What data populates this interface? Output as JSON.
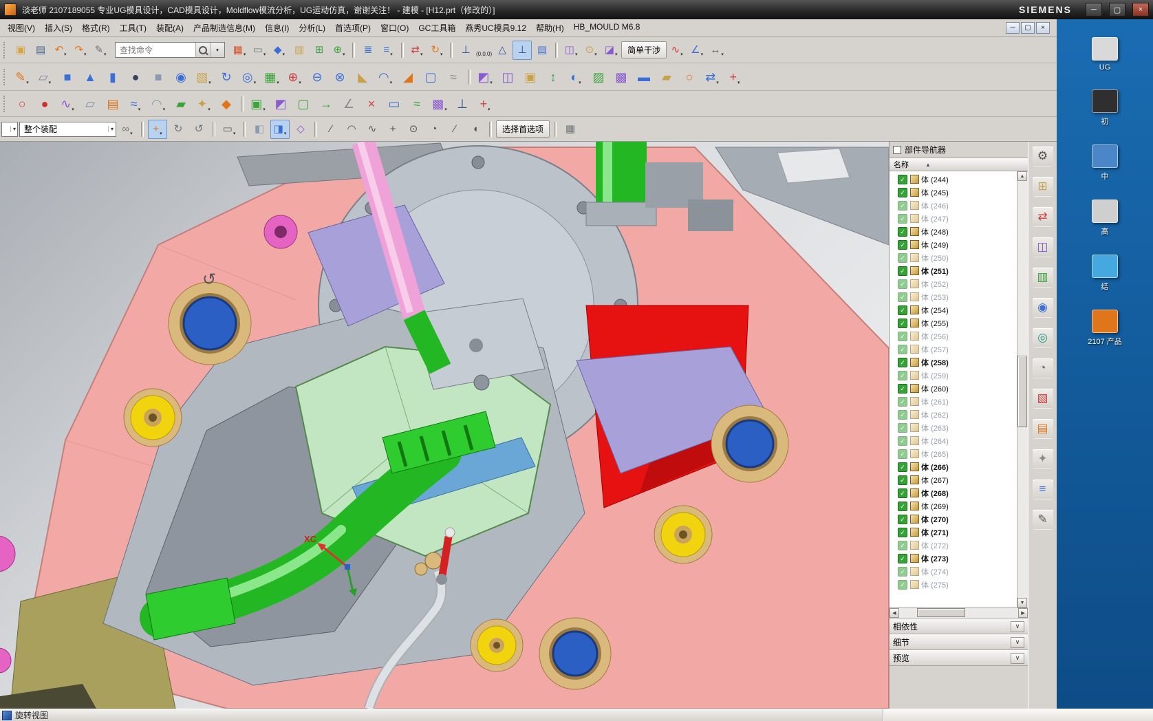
{
  "window": {
    "title": "淡老师 2107189055 专业UG模具设计，CAD模具设计，Moldflow模流分析，UG运动仿真，谢谢关注！ - 建模 - [H12.prt（修改的）]",
    "brand": "SIEMENS"
  },
  "menu": {
    "items": [
      "视图(V)",
      "插入(S)",
      "格式(R)",
      "工具(T)",
      "装配(A)",
      "产品制造信息(M)",
      "信息(I)",
      "分析(L)",
      "首选项(P)",
      "窗口(O)",
      "GC工具箱",
      "燕秀UC模具9.12",
      "帮助(H)",
      "HB_MOULD M6.8"
    ]
  },
  "toolbars": {
    "search_placeholder": "查找命令",
    "row1a": [
      {
        "n": "open",
        "g": "▣",
        "c": "#d8a43c"
      },
      {
        "n": "save",
        "g": "▤",
        "c": "#44628e"
      },
      {
        "n": "undo",
        "g": "↶",
        "c": "#e0761c",
        "a": 1
      },
      {
        "n": "redo",
        "g": "↷",
        "c": "#e0761c",
        "a": 1
      },
      {
        "n": "format-painter",
        "g": "✎",
        "c": "#6e7478",
        "a": 1
      }
    ],
    "row1b": [
      {
        "n": "arrange-windows",
        "g": "▦",
        "c": "#d8552a",
        "a": 1
      },
      {
        "n": "display-mode",
        "g": "▭",
        "c": "#6e7478",
        "a": 1
      },
      {
        "n": "orient-view",
        "g": "◆",
        "c": "#3a6fd8",
        "a": 1
      },
      {
        "n": "snapshot",
        "g": "▥",
        "c": "#c8a24a"
      },
      {
        "n": "fit-view",
        "g": "⊞",
        "c": "#3aa33a"
      },
      {
        "n": "zoom-view",
        "g": "⊕",
        "c": "#3aa33a",
        "a": 1
      },
      {
        "sep": 1
      },
      {
        "n": "layer-settings",
        "g": "≣",
        "c": "#3a6fd8"
      },
      {
        "n": "view-layer",
        "g": "≡",
        "c": "#3a6fd8",
        "a": 1
      },
      {
        "sep": 1
      },
      {
        "n": "move-object",
        "g": "⇄",
        "c": "#d04040",
        "a": 1
      },
      {
        "n": "rotate-object",
        "g": "↻",
        "c": "#e0761c",
        "a": 1
      },
      {
        "sep": 1
      },
      {
        "n": "datum-csys",
        "g": "⊥",
        "c": "#2a4a9a"
      },
      {
        "n": "wcs-origin",
        "text": "(0,0,0)"
      },
      {
        "n": "wcs-set",
        "g": "△",
        "c": "#2a4a9a"
      },
      {
        "n": "wcs-dynamics",
        "g": "⊥",
        "c": "#2a4a9a",
        "hl": 1
      },
      {
        "n": "save-displayed-part",
        "g": "▤",
        "c": "#3a6fd8"
      },
      {
        "sep": 1
      },
      {
        "n": "assembly-clearance",
        "g": "◫",
        "c": "#8a5ad0",
        "a": 1
      },
      {
        "n": "spotlight",
        "g": "⊙",
        "c": "#c8a24a",
        "a": 1
      },
      {
        "n": "section-view",
        "g": "◪",
        "c": "#8a5ad0",
        "a": 1
      },
      {
        "n": "simple-interference",
        "label": "简单干涉"
      },
      {
        "n": "curve-analysis",
        "g": "∿",
        "c": "#d03030",
        "a": 1
      },
      {
        "n": "measure-angle",
        "g": "∠",
        "c": "#3a6fd8",
        "a": 1
      },
      {
        "n": "measure-distance",
        "g": "↔",
        "c": "#555555",
        "a": 1
      }
    ],
    "row2": [
      {
        "n": "sketch",
        "g": "✎",
        "c": "#e0761c",
        "a": 1
      },
      {
        "n": "datum-plane",
        "g": "▱",
        "c": "#7a8aa0",
        "a": 1
      },
      {
        "n": "cube",
        "g": "■",
        "c": "#3a6fd8"
      },
      {
        "n": "cone",
        "g": "▲",
        "c": "#3a6fd8"
      },
      {
        "n": "cylinder",
        "g": "▮",
        "c": "#3a6fd8"
      },
      {
        "n": "sphere",
        "g": "●",
        "c": "#36445e"
      },
      {
        "n": "block",
        "g": "■",
        "c": "#8a9ab0"
      },
      {
        "n": "boss",
        "g": "◉",
        "c": "#3a6fd8"
      },
      {
        "n": "extrude",
        "g": "▧",
        "c": "#c8a24a",
        "a": 1
      },
      {
        "n": "revolve",
        "g": "↻",
        "c": "#3a6fd8"
      },
      {
        "n": "hole",
        "g": "◎",
        "c": "#3a6fd8",
        "a": 1
      },
      {
        "n": "pattern-feature",
        "g": "▦",
        "c": "#3aa33a",
        "a": 1
      },
      {
        "n": "unite",
        "g": "⊕",
        "c": "#d04040",
        "a": 1
      },
      {
        "n": "subtract",
        "g": "⊖",
        "c": "#3a6fd8"
      },
      {
        "n": "intersect",
        "g": "⊗",
        "c": "#3a6fd8"
      },
      {
        "n": "chamfer",
        "g": "◣",
        "c": "#c8a24a"
      },
      {
        "n": "edge-blend",
        "g": "◠",
        "c": "#3a6fd8",
        "a": 1
      },
      {
        "n": "draft",
        "g": "◢",
        "c": "#e0761c"
      },
      {
        "n": "shell",
        "g": "▢",
        "c": "#3a6fd8"
      },
      {
        "n": "thread",
        "g": "≈",
        "c": "#8a8a8a"
      },
      {
        "sep": 1
      },
      {
        "n": "trim-body",
        "g": "◩",
        "c": "#8a5ad0",
        "a": 1
      },
      {
        "n": "split-body",
        "g": "◫",
        "c": "#8a5ad0"
      },
      {
        "n": "offset-face",
        "g": "▣",
        "c": "#c8a24a"
      },
      {
        "n": "scale-body",
        "g": "↕",
        "c": "#3aa33a"
      },
      {
        "n": "mirror-feature",
        "g": "◐",
        "c": "#3a6fd8",
        "a": 1
      },
      {
        "n": "patch",
        "g": "▨",
        "c": "#3aa33a"
      },
      {
        "n": "sew",
        "g": "▩",
        "c": "#8a5ad0"
      },
      {
        "n": "thicken",
        "g": "▬",
        "c": "#3a6fd8"
      },
      {
        "n": "emboss",
        "g": "▰",
        "c": "#c8a24a"
      },
      {
        "n": "wrap-geometry",
        "g": "○",
        "c": "#e0761c"
      },
      {
        "n": "move-face",
        "g": "⇄",
        "c": "#3a6fd8",
        "a": 1
      },
      {
        "n": "synchronous-move",
        "g": "+",
        "c": "#d04040",
        "a": 1
      }
    ],
    "row3": [
      {
        "n": "ellipse",
        "g": "○",
        "c": "#d04040"
      },
      {
        "n": "art-spline",
        "g": "●",
        "c": "#d03030"
      },
      {
        "n": "studio-spline",
        "g": "∿",
        "c": "#8a5ad0",
        "a": 1
      },
      {
        "n": "four-point-surface",
        "g": "▱",
        "c": "#7a8aa0"
      },
      {
        "n": "ruled-surface",
        "g": "▤",
        "c": "#e0761c"
      },
      {
        "n": "through-curves",
        "g": "≈",
        "c": "#3a6fd8",
        "a": 1
      },
      {
        "n": "swept",
        "g": "◠",
        "c": "#8a9ab0",
        "a": 1
      },
      {
        "n": "fill-surface",
        "g": "▰",
        "c": "#3aa33a"
      },
      {
        "n": "x-form",
        "g": "✦",
        "c": "#c8a24a",
        "a": 1
      },
      {
        "n": "i-form",
        "g": "◆",
        "c": "#e0761c"
      },
      {
        "sep": 1
      },
      {
        "n": "offset-surface",
        "g": "▣",
        "c": "#3aa33a",
        "a": 1
      },
      {
        "n": "trimmed-sheet",
        "g": "◩",
        "c": "#8a5ad0"
      },
      {
        "n": "untrim",
        "g": "▢",
        "c": "#3aa33a"
      },
      {
        "n": "extend-sheet",
        "g": "→",
        "c": "#3aa33a"
      },
      {
        "n": "law-extension",
        "g": "∠",
        "c": "#8a8a8a"
      },
      {
        "n": "snip-surface",
        "g": "×",
        "c": "#d04040"
      },
      {
        "n": "bounded-plane",
        "g": "▭",
        "c": "#3a6fd8"
      },
      {
        "n": "refit-surface",
        "g": "≈",
        "c": "#3aa33a"
      },
      {
        "n": "sew-sheet",
        "g": "▩",
        "c": "#8a5ad0",
        "a": 1
      },
      {
        "n": "datum-axis",
        "g": "⊥",
        "c": "#2a4a9a"
      },
      {
        "n": "move-component",
        "g": "+",
        "c": "#d04040",
        "a": 1
      }
    ]
  },
  "selbar": {
    "scope_value": "整个装配",
    "icons": [
      {
        "n": "wave-link",
        "g": "∞",
        "c": "#7a7a7a",
        "a": 1
      },
      {
        "sep": 1
      },
      {
        "n": "snap-point",
        "g": "+",
        "c": "#e0761c",
        "hl": 1,
        "a": 1
      },
      {
        "n": "derived-rotate-cw",
        "g": "↻",
        "c": "#6e7478"
      },
      {
        "n": "derived-rotate-ccw",
        "g": "↺",
        "c": "#6e7478"
      },
      {
        "sep": 1
      },
      {
        "n": "marquee-select",
        "g": "▭",
        "c": "#555555",
        "a": 1
      },
      {
        "sep": 1
      },
      {
        "n": "shaded-view",
        "g": "◧",
        "c": "#8a9ab0"
      },
      {
        "n": "shaded-with-edges",
        "g": "◨",
        "c": "#3a6fd8",
        "hl": 1,
        "a": 1
      },
      {
        "n": "snap-scene",
        "g": "◇",
        "c": "#8a5ad0"
      },
      {
        "sep": 1
      },
      {
        "n": "snap-line",
        "g": "∕",
        "c": "#555555"
      },
      {
        "n": "snap-arc",
        "g": "◠",
        "c": "#555555"
      },
      {
        "n": "snap-spline",
        "g": "∿",
        "c": "#555555"
      },
      {
        "n": "snap-intersection",
        "g": "+",
        "c": "#555555"
      },
      {
        "n": "snap-center",
        "g": "⊙",
        "c": "#555555"
      },
      {
        "n": "snap-quadrant",
        "g": "◔",
        "c": "#555555"
      },
      {
        "n": "snap-point-on-curve",
        "g": "∕",
        "c": "#555555"
      },
      {
        "n": "snap-face",
        "g": "◖",
        "c": "#555555"
      },
      {
        "sep": 1
      },
      {
        "n": "selection-preferences",
        "label": "选择首选项"
      },
      {
        "sep": 1
      },
      {
        "n": "grid",
        "g": "▦",
        "c": "#6e7478"
      }
    ]
  },
  "navigator": {
    "title": "部件导航器",
    "column_header": "名称",
    "sections": [
      "相依性",
      "细节",
      "预览"
    ],
    "items": [
      {
        "label": "体 (244)",
        "style": "normal",
        "checked": true
      },
      {
        "label": "体 (245)",
        "style": "normal",
        "checked": true
      },
      {
        "label": "体 (246)",
        "style": "dim",
        "checked": true
      },
      {
        "label": "体 (247)",
        "style": "dim",
        "checked": true
      },
      {
        "label": "体 (248)",
        "style": "normal",
        "checked": true
      },
      {
        "label": "体 (249)",
        "style": "normal",
        "checked": true
      },
      {
        "label": "体 (250)",
        "style": "dim",
        "checked": true
      },
      {
        "label": "体 (251)",
        "style": "bold",
        "checked": true
      },
      {
        "label": "体 (252)",
        "style": "dim",
        "checked": true
      },
      {
        "label": "体 (253)",
        "style": "dim",
        "checked": true
      },
      {
        "label": "体 (254)",
        "style": "normal",
        "checked": true
      },
      {
        "label": "体 (255)",
        "style": "normal",
        "checked": true
      },
      {
        "label": "体 (256)",
        "style": "dim",
        "checked": true
      },
      {
        "label": "体 (257)",
        "style": "dim",
        "checked": true
      },
      {
        "label": "体 (258)",
        "style": "bold",
        "checked": true
      },
      {
        "label": "体 (259)",
        "style": "dim",
        "checked": true
      },
      {
        "label": "体 (260)",
        "style": "normal",
        "checked": true
      },
      {
        "label": "体 (261)",
        "style": "dim",
        "checked": true
      },
      {
        "label": "体 (262)",
        "style": "dim",
        "checked": true
      },
      {
        "label": "体 (263)",
        "style": "dim",
        "checked": true
      },
      {
        "label": "体 (264)",
        "style": "dim",
        "checked": true
      },
      {
        "label": "体 (265)",
        "style": "dim",
        "checked": true
      },
      {
        "label": "体 (266)",
        "style": "bold",
        "checked": true
      },
      {
        "label": "体 (267)",
        "style": "normal",
        "checked": true
      },
      {
        "label": "体 (268)",
        "style": "bold",
        "checked": true
      },
      {
        "label": "体 (269)",
        "style": "normal",
        "checked": true
      },
      {
        "label": "体 (270)",
        "style": "bold",
        "checked": true
      },
      {
        "label": "体 (271)",
        "style": "bold",
        "checked": true
      },
      {
        "label": "体 (272)",
        "style": "dim",
        "checked": true
      },
      {
        "label": "体 (273)",
        "style": "bold",
        "checked": true
      },
      {
        "label": "体 (274)",
        "style": "dim",
        "checked": true
      },
      {
        "label": "体 (275)",
        "style": "dim",
        "checked": true
      }
    ]
  },
  "resource": {
    "icons": [
      {
        "n": "settings-gear",
        "g": "⚙",
        "c": "#555555"
      },
      {
        "n": "assembly-navigator",
        "g": "⊞",
        "c": "#c8a24a"
      },
      {
        "n": "constraint-navigator",
        "g": "⇄",
        "c": "#d04040"
      },
      {
        "n": "part-navigator",
        "g": "◫",
        "c": "#8a5ad0"
      },
      {
        "n": "reuse-library",
        "g": "▥",
        "c": "#3aa33a"
      },
      {
        "n": "hd3d-tools",
        "g": "◉",
        "c": "#3a6fd8"
      },
      {
        "n": "web-browser",
        "g": "◎",
        "c": "#2a9a8a"
      },
      {
        "n": "history-palette",
        "g": "◔",
        "c": "#6e7478"
      },
      {
        "n": "color-palette",
        "g": "▧",
        "c": "#d04040"
      },
      {
        "n": "process-studio",
        "g": "▤",
        "c": "#e0761c"
      },
      {
        "n": "manufacturing-wizard",
        "g": "✦",
        "c": "#8a8a8a"
      },
      {
        "n": "roles",
        "g": "≡",
        "c": "#3a6fd8"
      },
      {
        "n": "system-scenes",
        "g": "✎",
        "c": "#555555"
      }
    ]
  },
  "desktop": {
    "icons": [
      {
        "label": "UG",
        "color": "#d9d9d9"
      },
      {
        "label": "初",
        "color": "#2f2f2f"
      },
      {
        "label": "中",
        "color": "#4a86c8"
      },
      {
        "label": "高",
        "color": "#cfcfcf"
      },
      {
        "label": "结",
        "color": "#45a8de"
      },
      {
        "label": "2107 产品",
        "color": "#e0761c"
      }
    ]
  },
  "viewport": {
    "xc_label": "XC"
  },
  "statusbar": {
    "message": "旋转视图"
  }
}
